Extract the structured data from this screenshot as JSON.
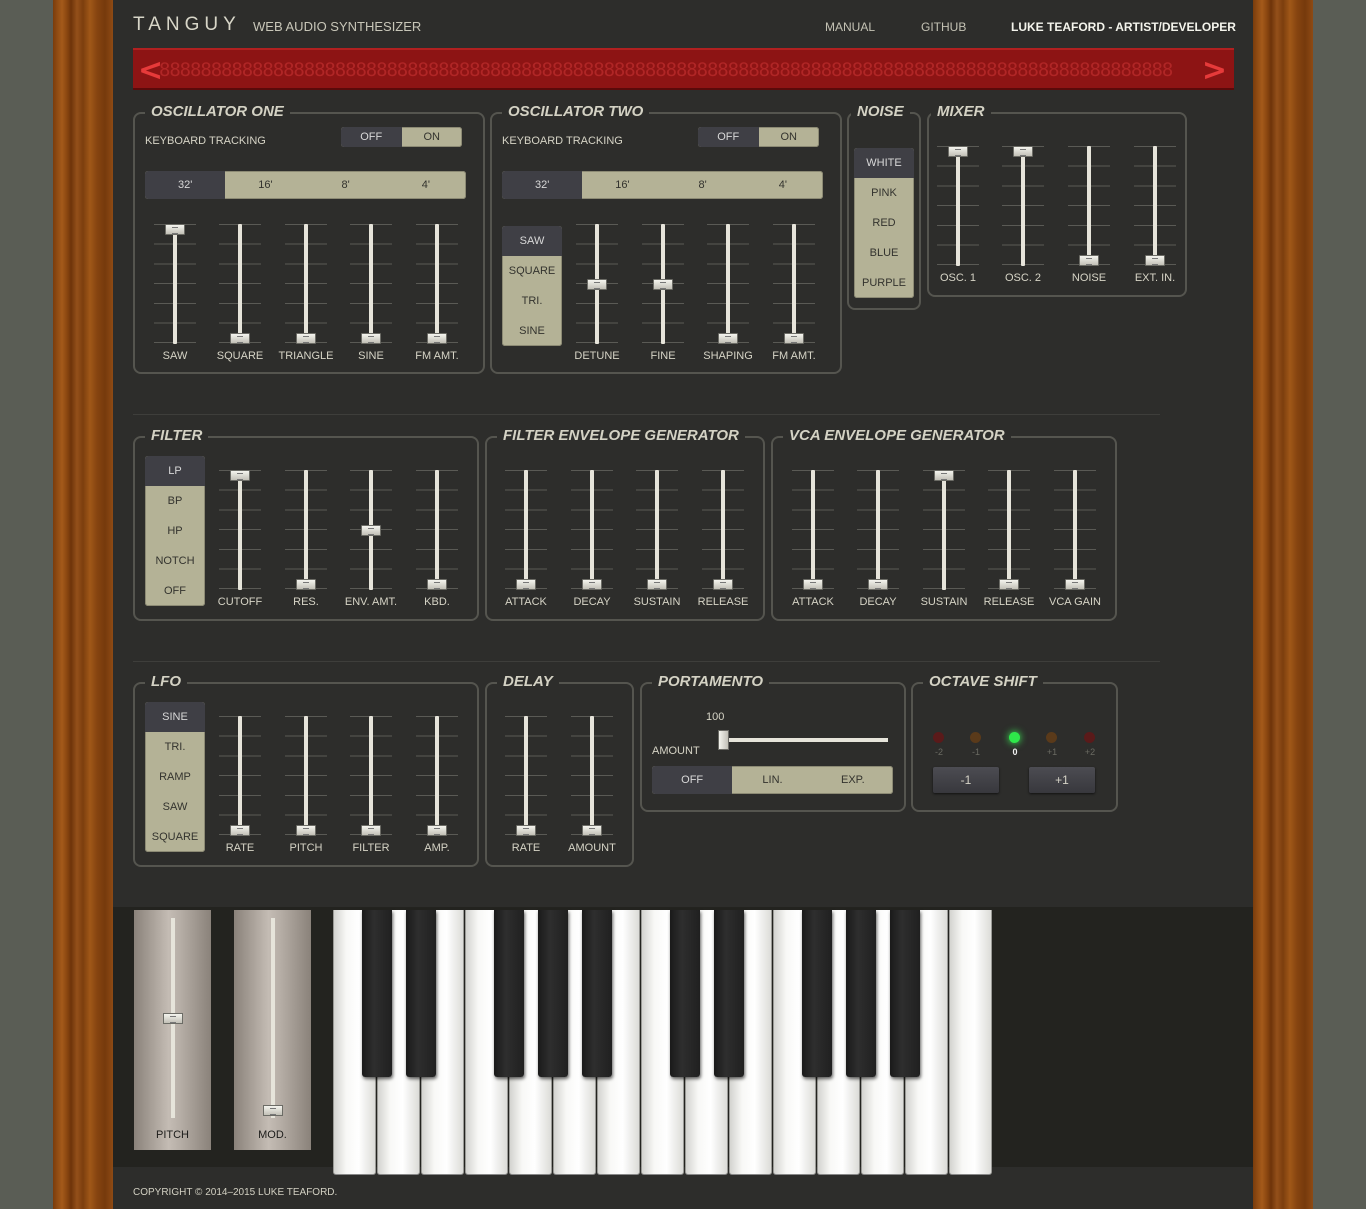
{
  "header": {
    "brand": "TANGUY",
    "subtitle": "WEB AUDIO SYNTHESIZER",
    "nav": [
      "MANUAL",
      "GITHUB",
      "LUKE TEAFORD - ARTIST/DEVELOPER"
    ]
  },
  "display": {
    "text": "88888888888888888888888888888888888888888888888888888888888888888888888888888888888888888888888888",
    "left_arrow": "<",
    "right_arrow": ">"
  },
  "osc1": {
    "title": "OSCILLATOR ONE",
    "tracking_label": "KEYBOARD TRACKING",
    "tracking": {
      "options": [
        "OFF",
        "ON"
      ],
      "selected": "OFF"
    },
    "range": {
      "options": [
        "32'",
        "16'",
        "8'",
        "4'"
      ],
      "selected": "32'"
    },
    "sliders": [
      {
        "label": "SAW",
        "value": 1.0
      },
      {
        "label": "SQUARE",
        "value": 0.0
      },
      {
        "label": "TRIANGLE",
        "value": 0.0
      },
      {
        "label": "SINE",
        "value": 0.0
      },
      {
        "label": "FM AMT.",
        "value": 0.0
      }
    ]
  },
  "osc2": {
    "title": "OSCILLATOR TWO",
    "tracking_label": "KEYBOARD TRACKING",
    "tracking": {
      "options": [
        "OFF",
        "ON"
      ],
      "selected": "OFF"
    },
    "range": {
      "options": [
        "32'",
        "16'",
        "8'",
        "4'"
      ],
      "selected": "32'"
    },
    "waveform": {
      "options": [
        "SAW",
        "SQUARE",
        "TRI.",
        "SINE"
      ],
      "selected": "SAW"
    },
    "sliders": [
      {
        "label": "DETUNE",
        "value": 0.5
      },
      {
        "label": "FINE",
        "value": 0.5
      },
      {
        "label": "SHAPING",
        "value": 0.0
      },
      {
        "label": "FM AMT.",
        "value": 0.0
      }
    ]
  },
  "noise": {
    "title": "NOISE",
    "options": [
      "WHITE",
      "PINK",
      "RED",
      "BLUE",
      "PURPLE"
    ],
    "selected": "WHITE"
  },
  "mixer": {
    "title": "MIXER",
    "sliders": [
      {
        "label": "OSC. 1",
        "value": 1.0
      },
      {
        "label": "OSC. 2",
        "value": 1.0
      },
      {
        "label": "NOISE",
        "value": 0.0
      },
      {
        "label": "EXT. IN.",
        "value": 0.0
      }
    ]
  },
  "filter": {
    "title": "FILTER",
    "modes": {
      "options": [
        "LP",
        "BP",
        "HP",
        "NOTCH",
        "OFF"
      ],
      "selected": "LP"
    },
    "sliders": [
      {
        "label": "CUTOFF",
        "value": 1.0
      },
      {
        "label": "RES.",
        "value": 0.0
      },
      {
        "label": "ENV. AMT.",
        "value": 0.5
      },
      {
        "label": "KBD.",
        "value": 0.0
      }
    ]
  },
  "filter_env": {
    "title": "FILTER ENVELOPE GENERATOR",
    "sliders": [
      {
        "label": "ATTACK",
        "value": 0.0
      },
      {
        "label": "DECAY",
        "value": 0.0
      },
      {
        "label": "SUSTAIN",
        "value": 0.0
      },
      {
        "label": "RELEASE",
        "value": 0.0
      }
    ]
  },
  "vca_env": {
    "title": "VCA ENVELOPE GENERATOR",
    "sliders": [
      {
        "label": "ATTACK",
        "value": 0.0
      },
      {
        "label": "DECAY",
        "value": 0.0
      },
      {
        "label": "SUSTAIN",
        "value": 1.0
      },
      {
        "label": "RELEASE",
        "value": 0.0
      },
      {
        "label": "VCA GAIN",
        "value": 0.0
      }
    ]
  },
  "lfo": {
    "title": "LFO",
    "waveform": {
      "options": [
        "SINE",
        "TRI.",
        "RAMP",
        "SAW",
        "SQUARE"
      ],
      "selected": "SINE"
    },
    "sliders": [
      {
        "label": "RATE",
        "value": 0.0
      },
      {
        "label": "PITCH",
        "value": 0.0
      },
      {
        "label": "FILTER",
        "value": 0.0
      },
      {
        "label": "AMP.",
        "value": 0.0
      }
    ]
  },
  "delay": {
    "title": "DELAY",
    "sliders": [
      {
        "label": "RATE",
        "value": 0.0
      },
      {
        "label": "AMOUNT",
        "value": 0.0
      }
    ]
  },
  "portamento": {
    "title": "PORTAMENTO",
    "amount_label": "AMOUNT",
    "amount_value": "100",
    "amount_fraction": 0.0,
    "mode": {
      "options": [
        "OFF",
        "LIN.",
        "EXP."
      ],
      "selected": "OFF"
    }
  },
  "octave": {
    "title": "OCTAVE SHIFT",
    "levels": [
      "-2",
      "-1",
      "0",
      "+1",
      "+2"
    ],
    "selected": "0",
    "down_label": "-1",
    "up_label": "+1"
  },
  "wheels": [
    {
      "label": "PITCH",
      "value": 0.5
    },
    {
      "label": "MOD.",
      "value": 0.0
    }
  ],
  "footer": {
    "copyright": "COPYRIGHT © 2014–2015 LUKE TEAFORD."
  },
  "colors": {
    "panel": "#2d2d2b",
    "display_red": "#8d1414",
    "button_cream": "#b4b296",
    "button_active": "#3f3f45",
    "led_on": "#2ee84a"
  }
}
